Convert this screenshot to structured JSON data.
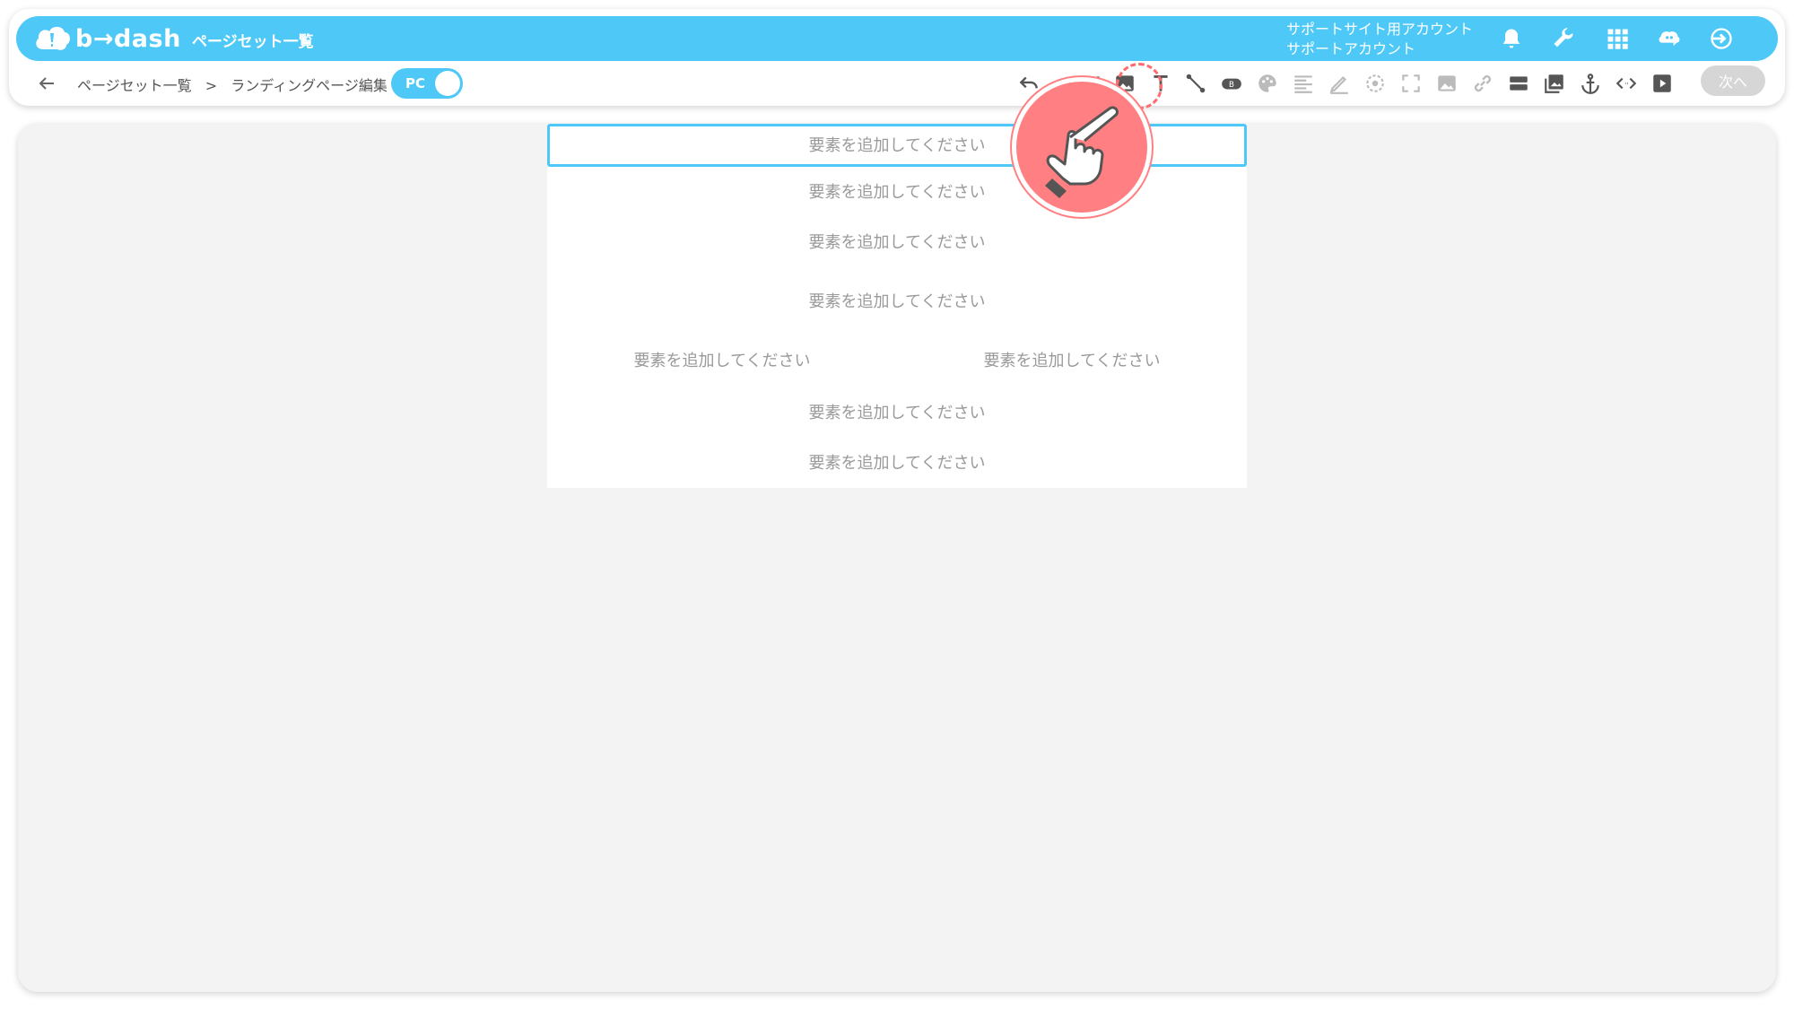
{
  "brand": {
    "name": "b→dash"
  },
  "header": {
    "title": "ページセット一覧",
    "account_line1": "サポートサイト用アカウント",
    "account_line2": "サポートアカウント",
    "icons": [
      "bell-icon",
      "wrench-icon",
      "apps-grid-icon",
      "chat-bot-icon",
      "logout-icon"
    ]
  },
  "breadcrumb": {
    "item1": "ページセット一覧",
    "separator": ">",
    "item2": "ランディングページ編集"
  },
  "toggle": {
    "label": "PC",
    "state": "on"
  },
  "toolbar": {
    "tools": [
      "undo-icon",
      "redo-icon",
      "barcode-icon",
      "image-icon",
      "text-icon",
      "line-icon",
      "button-icon",
      "palette-icon",
      "align-icon",
      "pen-icon",
      "target-icon",
      "expand-icon",
      "image-alt-icon",
      "link-icon",
      "layout-icon",
      "gallery-icon",
      "anchor-icon",
      "code-icon",
      "video-icon"
    ],
    "next_label": "次へ"
  },
  "canvas": {
    "placeholder_text": "要素を追加してください",
    "rows": [
      {
        "text": "要素を追加してください"
      },
      {
        "text": "要素を追加してください"
      },
      {
        "text": "要素を追加してください"
      },
      {
        "text": "要素を追加してください"
      },
      {
        "left": "要素を追加してください",
        "right": "要素を追加してください"
      },
      {
        "text": "要素を追加してください"
      },
      {
        "text": "要素を追加してください"
      }
    ]
  },
  "colors": {
    "accent": "#4ec9f7",
    "highlight": "#ff7f82",
    "canvas_bg": "#f3f3f3"
  }
}
